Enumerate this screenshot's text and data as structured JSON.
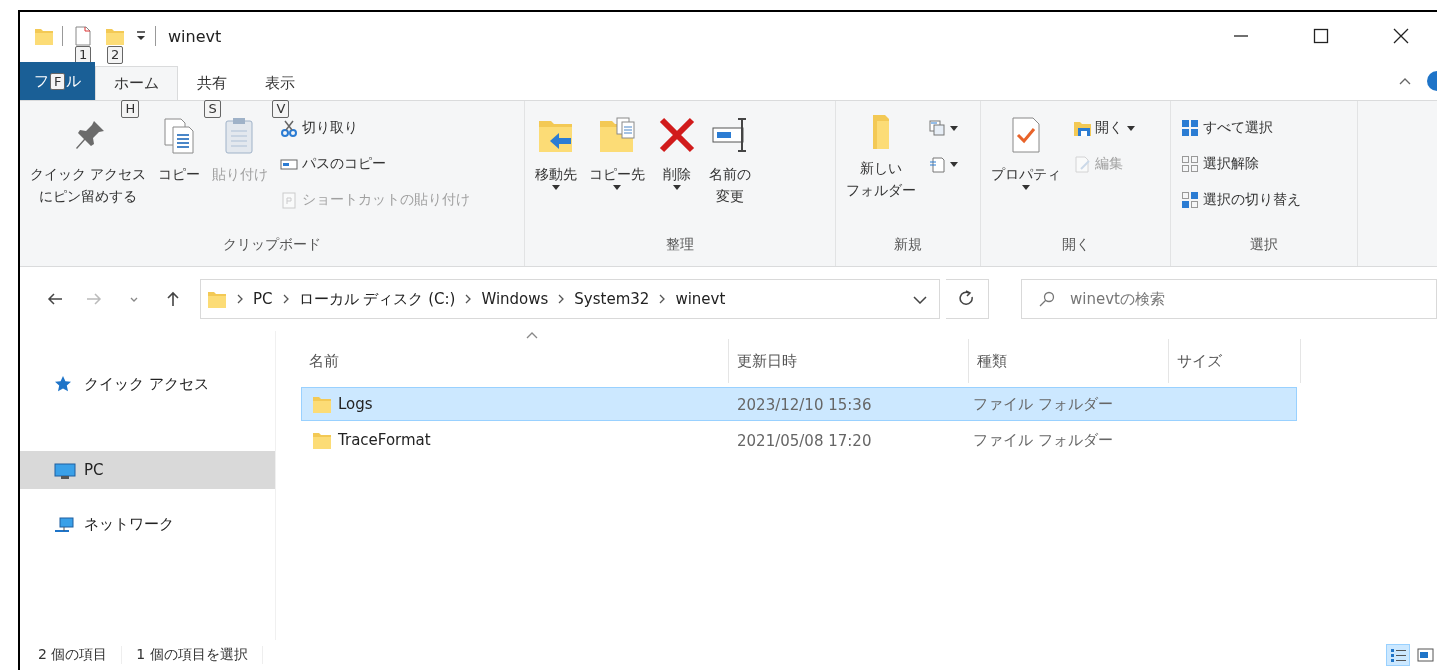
{
  "window": {
    "title": "winevt"
  },
  "quick_access_keytips": [
    "1",
    "2"
  ],
  "ribbon_tabs": [
    {
      "kind": "file",
      "label_parts": [
        "フ",
        "ル"
      ],
      "keytip": "F",
      "selected": false
    },
    {
      "kind": "tab",
      "label": "ホーム",
      "keytip": "H",
      "selected": true
    },
    {
      "kind": "tab",
      "label": "共有",
      "keytip": "S",
      "selected": false
    },
    {
      "kind": "tab",
      "label": "表示",
      "keytip": "V",
      "selected": false
    }
  ],
  "ribbon_groups": [
    {
      "label": "クリップボード",
      "items": [
        {
          "kind": "large",
          "lines": [
            "クイック アクセス",
            "にピン留めする"
          ],
          "dropdown": false,
          "disabled": false
        },
        {
          "kind": "large",
          "lines": [
            "コピー"
          ],
          "dropdown": false,
          "disabled": false
        },
        {
          "kind": "large",
          "lines": [
            "貼り付け"
          ],
          "dropdown": false,
          "disabled": true
        },
        {
          "kind": "stack",
          "items": [
            {
              "label": "切り取り",
              "dropdown": false,
              "disabled": false
            },
            {
              "label": "パスのコピー",
              "dropdown": false,
              "disabled": false
            },
            {
              "label": "ショートカットの貼り付け",
              "dropdown": false,
              "disabled": true
            }
          ]
        }
      ]
    },
    {
      "label": "整理",
      "items": [
        {
          "kind": "large",
          "lines": [
            "移動先"
          ],
          "dropdown": true,
          "disabled": false
        },
        {
          "kind": "large",
          "lines": [
            "コピー先"
          ],
          "dropdown": true,
          "disabled": false
        },
        {
          "kind": "large",
          "lines": [
            "削除"
          ],
          "dropdown": true,
          "disabled": false
        },
        {
          "kind": "large",
          "lines": [
            "名前の",
            "変更"
          ],
          "dropdown": false,
          "disabled": false
        }
      ]
    },
    {
      "label": "新規",
      "items": [
        {
          "kind": "large",
          "lines": [
            "新しい",
            "フォルダー"
          ],
          "dropdown": false,
          "disabled": false
        },
        {
          "kind": "stack",
          "items": [
            {
              "dropdown": true,
              "disabled": false
            },
            {
              "dropdown": true,
              "disabled": false
            }
          ]
        }
      ]
    },
    {
      "label": "開く",
      "items": [
        {
          "kind": "large",
          "lines": [
            "プロパティ"
          ],
          "dropdown": true,
          "disabled": false
        },
        {
          "kind": "stack",
          "items": [
            {
              "label": "開く",
              "dropdown": true,
              "disabled": false
            },
            {
              "label": "編集",
              "dropdown": false,
              "disabled": true
            }
          ]
        }
      ]
    },
    {
      "label": "選択",
      "items": [
        {
          "kind": "stack",
          "items": [
            {
              "label": "すべて選択",
              "dropdown": false,
              "disabled": false
            },
            {
              "label": "選択解除",
              "dropdown": false,
              "disabled": false
            },
            {
              "label": "選択の切り替え",
              "dropdown": false,
              "disabled": false
            }
          ]
        }
      ]
    }
  ],
  "navigation": {
    "back_disabled": false,
    "forward_disabled": true
  },
  "address_bar": {
    "segments": [
      "PC",
      "ローカル ディスク (C:)",
      "Windows",
      "System32",
      "winevt"
    ]
  },
  "search": {
    "placeholder": "winevtの検索"
  },
  "nav_pane": [
    {
      "label": "クイック アクセス",
      "selected": false
    },
    {
      "label": "PC",
      "selected": true
    },
    {
      "label": "ネットワーク",
      "selected": false
    }
  ],
  "file_list": {
    "columns": [
      {
        "label": "名前",
        "sorted": true
      },
      {
        "label": "更新日時",
        "sorted": false
      },
      {
        "label": "種類",
        "sorted": false
      },
      {
        "label": "サイズ",
        "sorted": false
      }
    ],
    "rows": [
      {
        "name": "Logs",
        "modified": "2023/12/10 15:36",
        "type": "ファイル フォルダー",
        "selected": true
      },
      {
        "name": "TraceFormat",
        "modified": "2021/05/08 17:20",
        "type": "ファイル フォルダー",
        "selected": false
      }
    ]
  },
  "status_bar": {
    "item_count": "2 個の項目",
    "selection": "1 個の項目を選択"
  },
  "view_buttons": [
    {
      "selected": true
    },
    {
      "selected": false
    }
  ]
}
